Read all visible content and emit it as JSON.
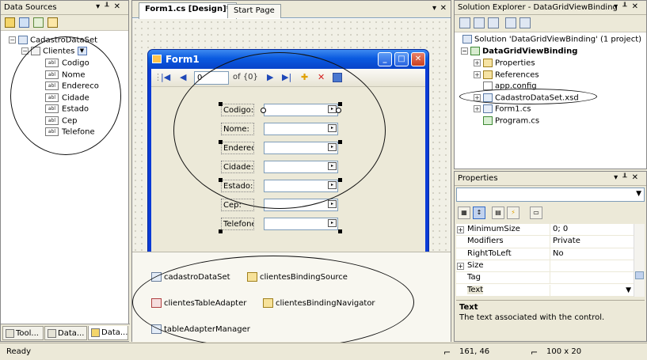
{
  "data_sources": {
    "title": "Data Sources",
    "dataset": "CadastroDataSet",
    "table": "Clientes",
    "fields": [
      "Codigo",
      "Nome",
      "Endereco",
      "Cidade",
      "Estado",
      "Cep",
      "Telefone"
    ],
    "tabs": [
      "Tool...",
      "Data...",
      "Data..."
    ]
  },
  "designer": {
    "tabs": [
      "Form1.cs [Design]*",
      "Start Page"
    ],
    "form_title": "Form1",
    "navigator": {
      "position": "0",
      "count": "of {0}"
    },
    "labels": [
      "Codigo:",
      "Nome:",
      "Endereco:",
      "Cidade:",
      "Estado:",
      "Cep:",
      "Telefone:"
    ],
    "components": [
      "cadastroDataSet",
      "clientesBindingSource",
      "clientesTableAdapter",
      "clientesBindingNavigator",
      "tableAdapterManager"
    ]
  },
  "solution_explorer": {
    "title": "Solution Explorer - DataGridViewBinding",
    "solution": "Solution 'DataGridViewBinding' (1 project)",
    "project": "DataGridViewBinding",
    "items": [
      "Properties",
      "References",
      "app.config",
      "CadastroDataSet.xsd",
      "Form1.cs",
      "Program.cs"
    ]
  },
  "properties": {
    "title": "Properties",
    "rows": [
      {
        "name": "MinimumSize",
        "value": "0; 0",
        "expand": "+"
      },
      {
        "name": "Modifiers",
        "value": "Private",
        "expand": ""
      },
      {
        "name": "RightToLeft",
        "value": "No",
        "expand": ""
      },
      {
        "name": "Size",
        "value": "",
        "expand": "+"
      },
      {
        "name": "Tag",
        "value": "",
        "expand": ""
      },
      {
        "name": "Text",
        "value": "",
        "expand": ""
      }
    ],
    "desc_title": "Text",
    "desc_text": "The text associated with the control."
  },
  "status": {
    "ready": "Ready",
    "position": "161, 46",
    "size": "100 x 20"
  },
  "colors": {
    "form_title": "#0a5ae0",
    "form_border": "#0a3bd6",
    "panel_bg": "#ece9d8"
  }
}
